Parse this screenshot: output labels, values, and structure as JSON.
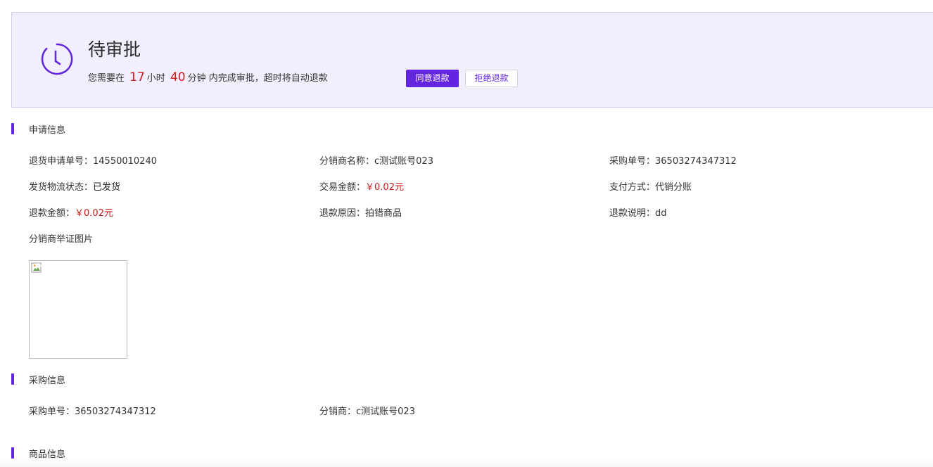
{
  "banner": {
    "icon": "clock-icon",
    "title": "待审批",
    "desc_prefix": "您需要在",
    "hours": "17",
    "hours_unit": "小时",
    "minutes": "40",
    "minutes_unit": "分钟",
    "desc_suffix": "内完成审批，超时将自动退款",
    "agree_label": "同意退款",
    "reject_label": "拒绝退款"
  },
  "apply_info": {
    "title": "申请信息",
    "fields": [
      {
        "label": "退货申请单号：",
        "value": "14550010240"
      },
      {
        "label": "分销商名称：",
        "value": "c测试账号023"
      },
      {
        "label": "采购单号：",
        "value": "36503274347312"
      },
      {
        "label": "发货物流状态：",
        "value": "已发货"
      },
      {
        "label": "交易金额：",
        "value": "￥0.02元"
      },
      {
        "label": "支付方式：",
        "value": "代销分账"
      },
      {
        "label": "退款金额：",
        "value": "￥0.02元"
      },
      {
        "label": "退款原因：",
        "value": "拍错商品"
      },
      {
        "label": "退款说明：",
        "value": "dd"
      }
    ],
    "evidence_label": "分销商举证图片"
  },
  "purchase_info": {
    "title": "采购信息",
    "fields": [
      {
        "label": "采购单号：",
        "value": "36503274347312"
      },
      {
        "label": "分销商：",
        "value": "c测试账号023"
      }
    ]
  },
  "product_info": {
    "title": "商品信息"
  },
  "colors": {
    "accent": "#6425e0",
    "banner_bg": "#f1effd",
    "price_red": "#cc1a1a"
  }
}
